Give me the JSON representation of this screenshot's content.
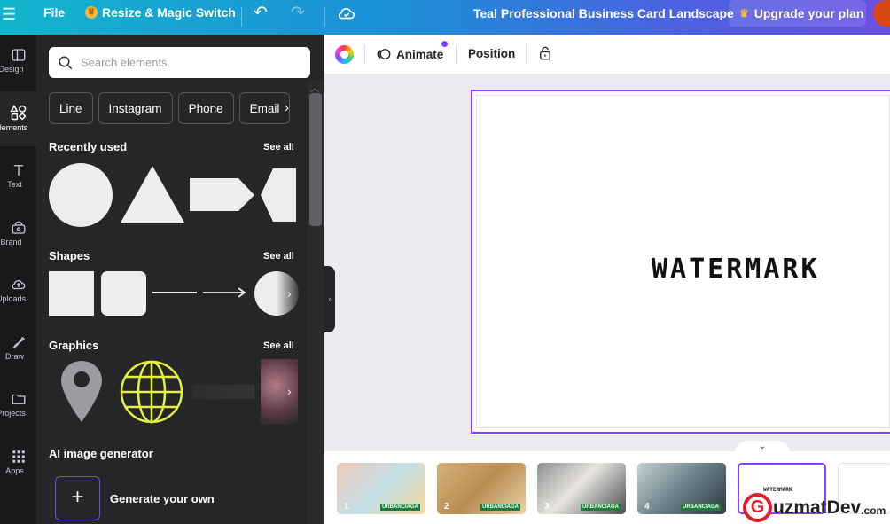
{
  "topbar": {
    "file_label": "File",
    "resize_label": "Resize & Magic Switch",
    "doc_title": "Teal Professional Business Card Landscape",
    "upgrade_label": "Upgrade your plan"
  },
  "rail": {
    "items": [
      {
        "label": "Design",
        "icon": "design-icon"
      },
      {
        "label": "Elements",
        "icon": "elements-icon"
      },
      {
        "label": "Text",
        "icon": "text-icon"
      },
      {
        "label": "Brand",
        "icon": "brand-icon"
      },
      {
        "label": "Uploads",
        "icon": "uploads-icon"
      },
      {
        "label": "Draw",
        "icon": "draw-icon"
      },
      {
        "label": "Projects",
        "icon": "projects-icon"
      },
      {
        "label": "Apps",
        "icon": "apps-icon"
      }
    ]
  },
  "panel": {
    "search_placeholder": "Search elements",
    "chips": [
      "Line",
      "Instagram",
      "Phone",
      "Email"
    ],
    "sections": {
      "recently_used": "Recently used",
      "shapes": "Shapes",
      "graphics": "Graphics",
      "ai_generator": "AI image generator"
    },
    "see_all": "See all",
    "generate_label": "Generate your own"
  },
  "toolbar": {
    "animate_label": "Animate",
    "position_label": "Position"
  },
  "canvas": {
    "watermark_text": "WATERMARK"
  },
  "filmstrip": {
    "pages": [
      {
        "num": "1",
        "tag": "URBANCIAGA"
      },
      {
        "num": "2",
        "tag": "URBANCIAGA"
      },
      {
        "num": "3",
        "tag": "URBANCIAGA"
      },
      {
        "num": "4",
        "tag": "URBANCIAGA"
      }
    ],
    "selected_mini": "WATERMARK"
  },
  "brand_badge": {
    "g": "G",
    "text_red": "",
    "text": "uzmatDev",
    "suffix": ".com"
  },
  "colors": {
    "accent": "#8b3dff",
    "panel_bg": "#252627",
    "rail_bg": "#18191b",
    "topbar_start": "#12b4cc",
    "topbar_end": "#6a4fe4"
  }
}
